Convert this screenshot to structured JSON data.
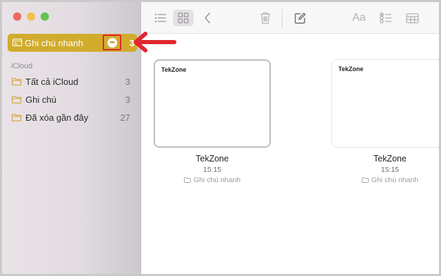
{
  "sidebar": {
    "quick_notes": {
      "label": "Ghi chú nhanh",
      "count": "3"
    },
    "section_title": "iCloud",
    "items": [
      {
        "label": "Tất cả iCloud",
        "count": "3"
      },
      {
        "label": "Ghi chú",
        "count": "3"
      },
      {
        "label": "Đã xóa gần đây",
        "count": "27"
      }
    ]
  },
  "toolbar": {
    "icons": [
      "list-view-icon",
      "gallery-view-icon",
      "back-icon",
      "trash-icon",
      "compose-icon",
      "format-icon",
      "checklist-icon",
      "table-icon"
    ],
    "format_label": "Aa"
  },
  "notes": [
    {
      "preview": "TekZone",
      "title": "TekZone",
      "time": "15:15",
      "folder": "Ghi chú nhanh"
    },
    {
      "preview": "TekZone",
      "title": "TekZone",
      "time": "15:15",
      "folder": "Ghi chú nhanh"
    }
  ],
  "colors": {
    "accent": "#d1ac2c",
    "annotation": "#e0262e"
  }
}
